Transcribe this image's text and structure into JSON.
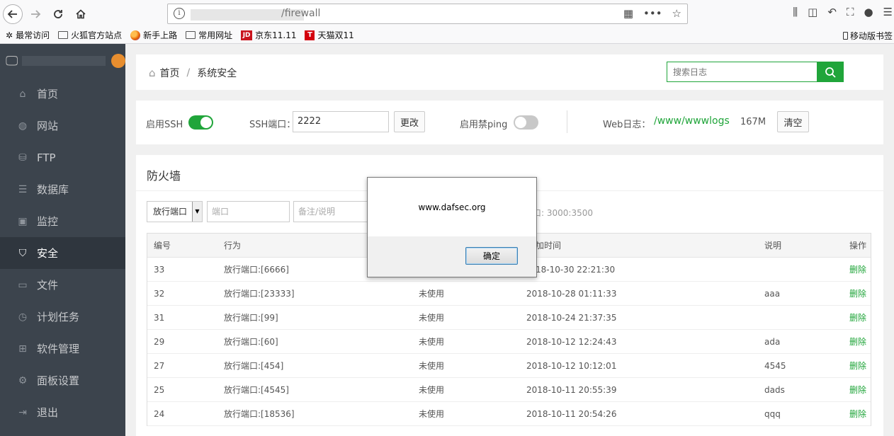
{
  "browser": {
    "url_path": "/firewall",
    "bookmarks": [
      {
        "label": "最常访问",
        "icon": "gear-icon"
      },
      {
        "label": "火狐官方站点",
        "icon": "folder-icon"
      },
      {
        "label": "新手上路",
        "icon": "firefox-icon"
      },
      {
        "label": "常用网址",
        "icon": "folder-icon"
      },
      {
        "label": "京东11.11",
        "icon": "jd-icon"
      },
      {
        "label": "天猫双11",
        "icon": "tmall-icon"
      }
    ],
    "mobile_bookmarks": "移动版书签"
  },
  "sidebar": {
    "items": [
      {
        "label": "首页",
        "icon": "home-icon"
      },
      {
        "label": "网站",
        "icon": "globe-icon"
      },
      {
        "label": "FTP",
        "icon": "ftp-icon"
      },
      {
        "label": "数据库",
        "icon": "database-icon"
      },
      {
        "label": "监控",
        "icon": "monitor-icon"
      },
      {
        "label": "安全",
        "icon": "shield-icon"
      },
      {
        "label": "文件",
        "icon": "folder-icon"
      },
      {
        "label": "计划任务",
        "icon": "clock-icon"
      },
      {
        "label": "软件管理",
        "icon": "grid-icon"
      },
      {
        "label": "面板设置",
        "icon": "gear-icon"
      },
      {
        "label": "退出",
        "icon": "logout-icon"
      }
    ],
    "active_index": 5
  },
  "breadcrumb": {
    "home": "首页",
    "separator": "/",
    "current": "系统安全"
  },
  "search": {
    "placeholder": "搜索日志"
  },
  "ssh": {
    "enable_label": "启用SSH",
    "port_label": "SSH端口：",
    "port_value": "2222",
    "change_button": "更改",
    "ping_label": "启用禁ping",
    "weblog_label": "Web日志：",
    "weblog_path": "/www/wwwlogs",
    "weblog_size": "167M",
    "clear_button": "清空"
  },
  "firewall": {
    "title": "防火墙",
    "select_value": "放行端口",
    "port_placeholder": "端口",
    "remark_placeholder": "备注/说明",
    "hint_fragment": "口: 3000:3500",
    "columns": [
      "编号",
      "行为",
      "",
      "加时间",
      "说明",
      "操作"
    ],
    "rows": [
      {
        "id": "33",
        "action": "放行端口:[6666]",
        "status": "",
        "time": "18-10-30 22:21:30",
        "note": "",
        "op": "删除"
      },
      {
        "id": "32",
        "action": "放行端口:[23333]",
        "status": "未使用",
        "time": "2018-10-28 01:11:33",
        "note": "aaa",
        "op": "删除"
      },
      {
        "id": "31",
        "action": "放行端口:[99]",
        "status": "未使用",
        "time": "2018-10-24 21:37:35",
        "note": "",
        "op": "删除"
      },
      {
        "id": "29",
        "action": "放行端口:[60]",
        "status": "未使用",
        "time": "2018-10-12 12:24:43",
        "note": "ada",
        "op": "删除"
      },
      {
        "id": "27",
        "action": "放行端口:[454]",
        "status": "未使用",
        "time": "2018-10-12 10:12:01",
        "note": "4545",
        "op": "删除"
      },
      {
        "id": "25",
        "action": "放行端口:[4545]",
        "status": "未使用",
        "time": "2018-10-11 20:55:39",
        "note": "dads",
        "op": "删除"
      },
      {
        "id": "24",
        "action": "放行端口:[18536]",
        "status": "未使用",
        "time": "2018-10-11 20:54:26",
        "note": "qqq",
        "op": "删除"
      }
    ]
  },
  "dialog": {
    "message": "www.dafsec.org",
    "ok_button": "确定"
  },
  "colors": {
    "accent": "#20a53a",
    "sidebar": "#3c444d"
  }
}
